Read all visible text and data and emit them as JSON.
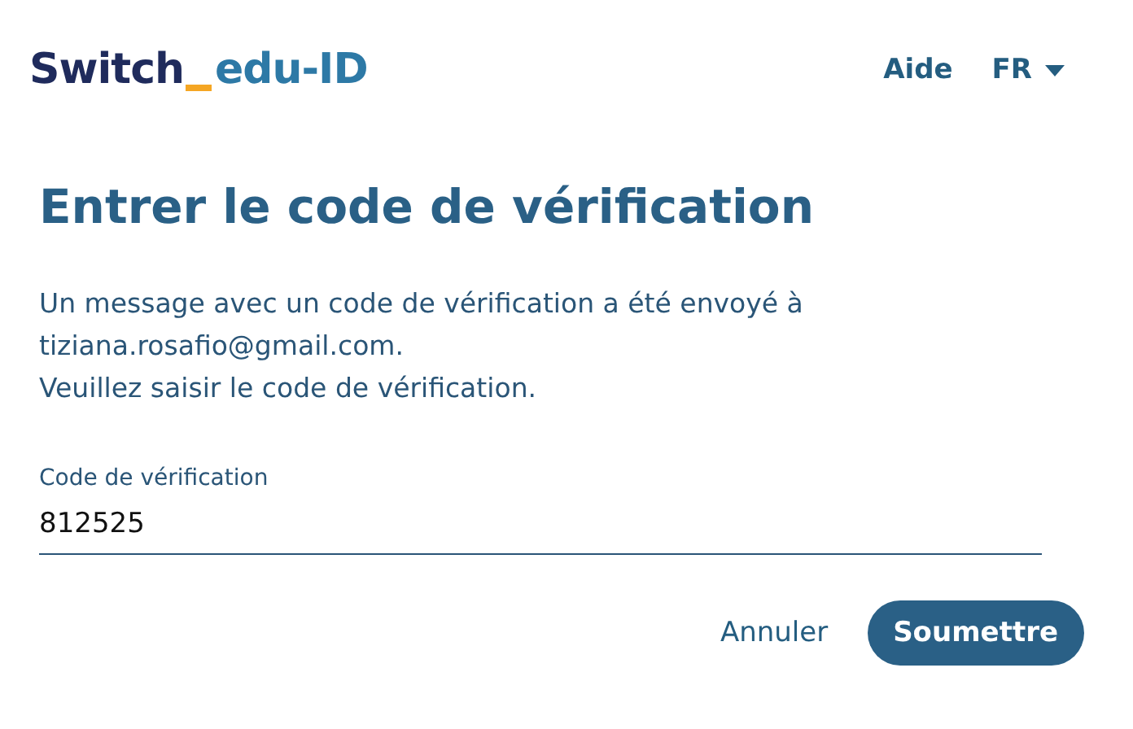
{
  "header": {
    "logo": {
      "brand": "Switch",
      "product": "edu-ID"
    },
    "help_link": "Aide",
    "language": {
      "label": "FR",
      "expanded": false
    }
  },
  "title": "Entrer le code de vérification",
  "message": [
    "Un message avec un code de vérification a été envoyé à",
    "tiziana.rosafio@gmail.com.",
    "Veuillez saisir le code de vérification."
  ],
  "field": {
    "label": "Code de vérification",
    "value": "812525"
  },
  "buttons": {
    "cancel": "Annuler",
    "submit": "Soumettre"
  }
}
